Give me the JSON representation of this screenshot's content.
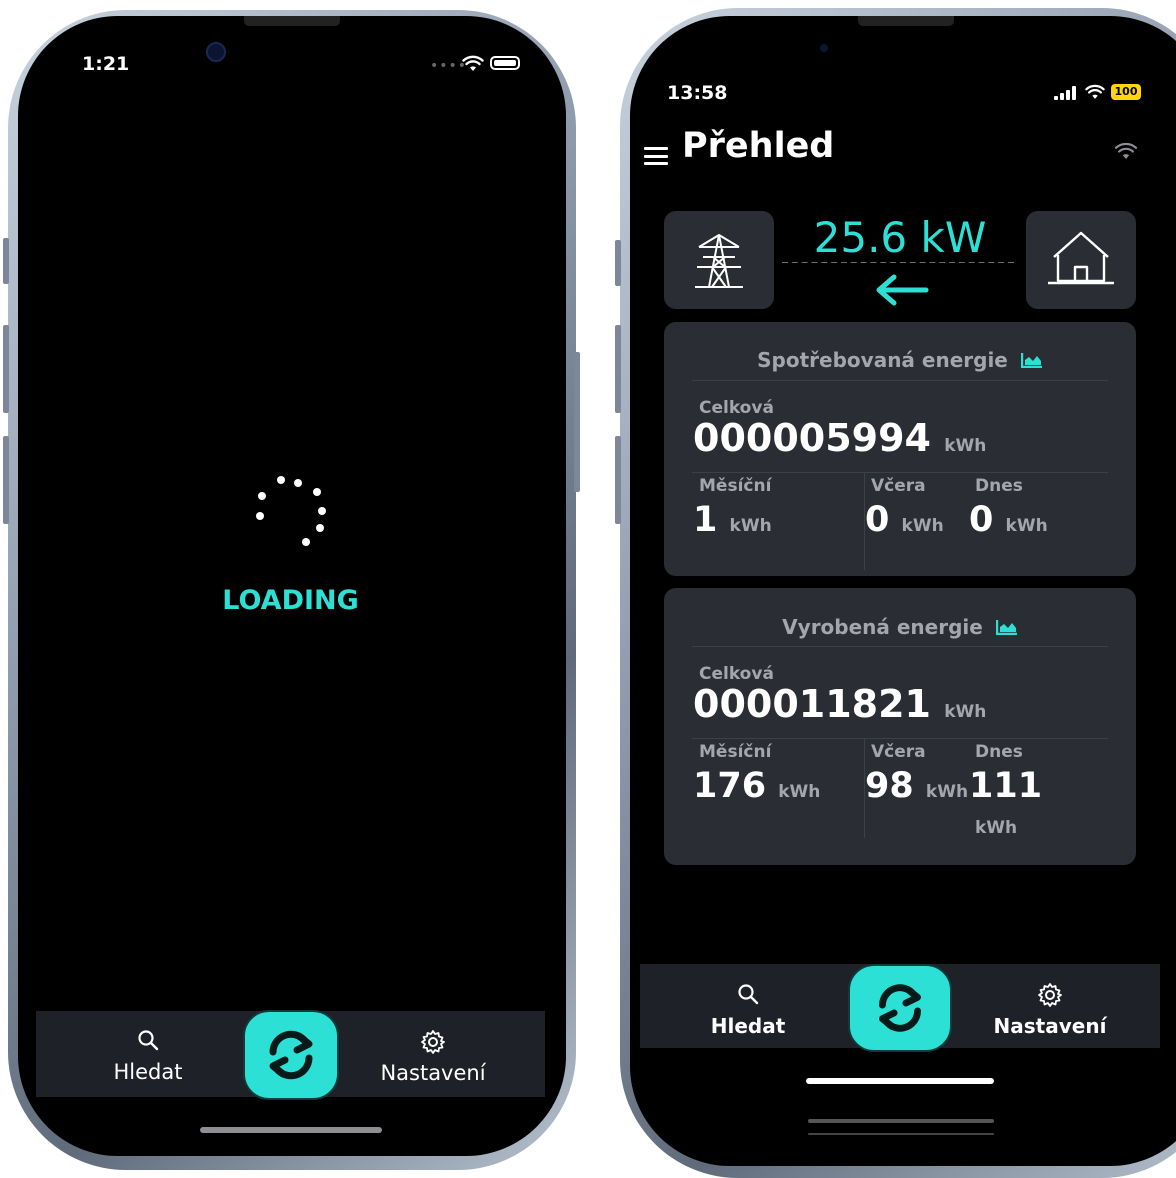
{
  "left_phone": {
    "status_time": "1:21",
    "loading_text": "LOADING",
    "tabbar": {
      "search_label": "Hledat",
      "settings_label": "Nastavení"
    }
  },
  "right_phone": {
    "status_time": "13:58",
    "battery": "100",
    "title": "Přehled",
    "power_flow": {
      "value": "25.6 kW",
      "direction": "to-grid"
    },
    "consumed": {
      "title": "Spotřebovaná energie",
      "total_label": "Celková",
      "total_value": "000005994",
      "unit": "kWh",
      "monthly_label": "Měsíční",
      "monthly_value": "1",
      "yesterday_label": "Včera",
      "yesterday_value": "0",
      "today_label": "Dnes",
      "today_value": "0"
    },
    "produced": {
      "title": "Vyrobená energie",
      "total_label": "Celková",
      "total_value": "000011821",
      "unit": "kWh",
      "monthly_label": "Měsíční",
      "monthly_value": "176",
      "yesterday_label": "Včera",
      "yesterday_value": "98",
      "today_label": "Dnes",
      "today_value": "111"
    },
    "tabbar": {
      "search_label": "Hledat",
      "settings_label": "Nastavení"
    }
  },
  "colors": {
    "accent": "#2de0d6",
    "card": "#2a2d33",
    "tabbar": "#1e2128",
    "battery": "#ffd60a"
  }
}
